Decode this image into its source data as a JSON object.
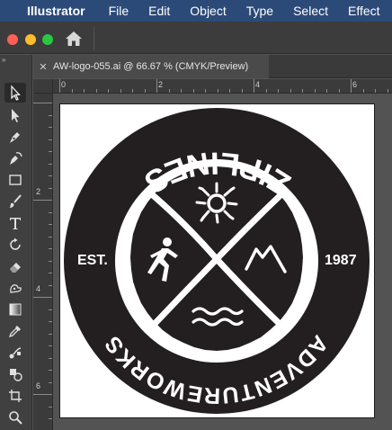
{
  "menubar": {
    "app_name": "Illustrator",
    "items": [
      "File",
      "Edit",
      "Object",
      "Type",
      "Select",
      "Effect"
    ]
  },
  "document": {
    "tab_title": "AW-logo-055.ai @ 66.67 % (CMYK/Preview)"
  },
  "rulers": {
    "horizontal_labels": [
      "0",
      "2",
      "4",
      "6"
    ],
    "vertical_labels": [
      "2",
      "4",
      "6"
    ]
  },
  "logo": {
    "top_text": "ZIPLINES",
    "bottom_text": "ADVENTUREWORKS",
    "left_text": "EST.",
    "right_text": "1987"
  },
  "toolbar": {
    "tools": [
      "selection-tool",
      "direct-selection-tool",
      "pen-tool",
      "curvature-tool",
      "rectangle-tool",
      "paintbrush-tool",
      "type-tool",
      "rotate-tool",
      "eraser-tool",
      "warp-tool",
      "gradient-tool",
      "eyedropper-tool",
      "blend-tool",
      "shape-builder-tool",
      "artboard-tool",
      "zoom-tool"
    ]
  },
  "colors": {
    "menubar_bg": "#2b4a78",
    "logo_ink": "#231f20",
    "artboard": "#ffffff"
  }
}
